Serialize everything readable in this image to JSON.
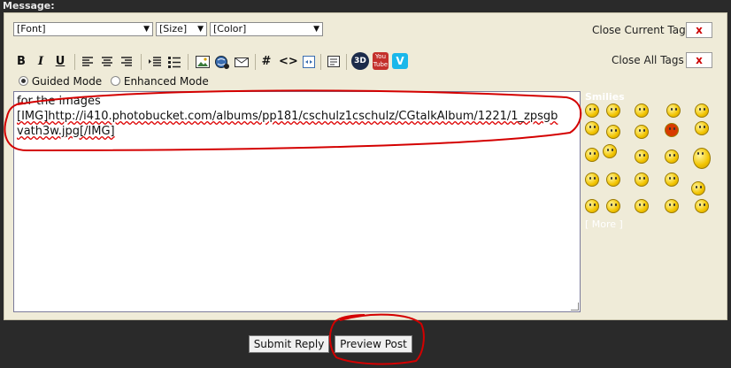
{
  "form": {
    "message_label": "Message:"
  },
  "selects": {
    "font": "[Font]",
    "size": "[Size]",
    "color": "[Color]"
  },
  "tag_actions": {
    "close_current_tag": "Close Current Tag",
    "close_all_tags": "Close All Tags",
    "close_symbol": "x"
  },
  "toolbar": {
    "bold": "B",
    "italic": "I",
    "underline": "U",
    "hash": "#",
    "code": "<>",
    "three_d": "3D",
    "youtube_top": "You",
    "youtube_bottom": "Tube",
    "vimeo": "V"
  },
  "modes": {
    "guided": "Guided Mode",
    "enhanced": "Enhanced Mode",
    "selected": "guided"
  },
  "editor": {
    "line1": "for the images",
    "line2": "[IMG]http://i410.photobucket.com/albums/pp181/cschulz1cschulz/CGtalkAlbum/1221/1_zpsgb",
    "line3": "vath3w.jpg[/IMG]"
  },
  "smilies": {
    "title": "Smilies",
    "more": "[ More ]"
  },
  "actions": {
    "submit": "Submit Reply",
    "preview": "Preview Post"
  },
  "colors": {
    "panel_bg": "#efebd8",
    "page_bg": "#2a2a2a",
    "annotation_red": "#d40000",
    "close_x": "#cc0000"
  }
}
